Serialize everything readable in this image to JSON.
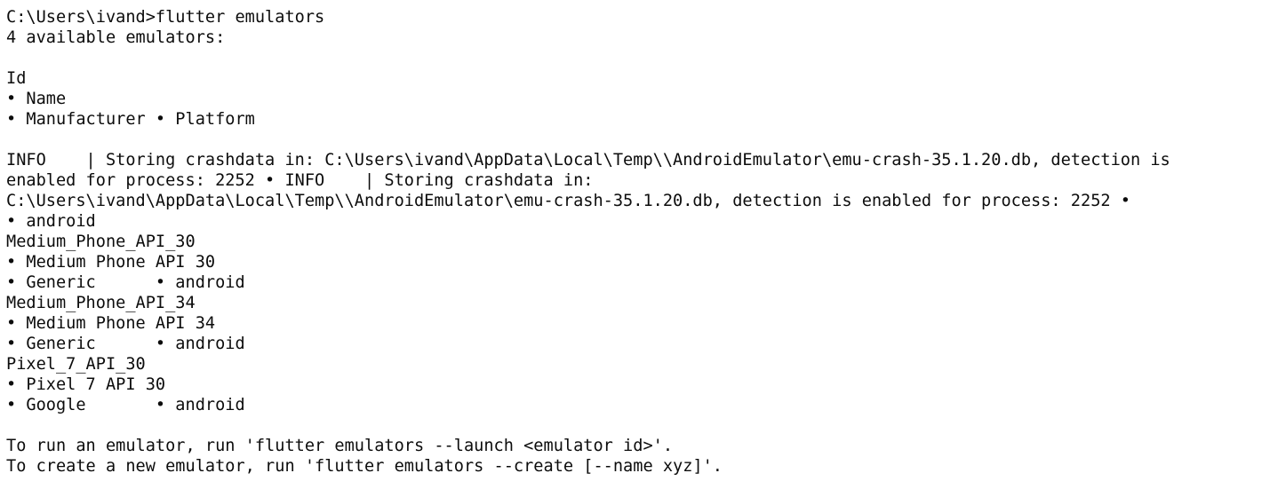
{
  "terminal": {
    "lines": [
      "C:\\Users\\ivand>flutter emulators",
      "4 available emulators:",
      "",
      "Id",
      "• Name",
      "• Manufacturer • Platform",
      "",
      "INFO    | Storing crashdata in: C:\\Users\\ivand\\AppData\\Local\\Temp\\\\AndroidEmulator\\emu-crash-35.1.20.db, detection is",
      "enabled for process: 2252 • INFO    | Storing crashdata in:",
      "C:\\Users\\ivand\\AppData\\Local\\Temp\\\\AndroidEmulator\\emu-crash-35.1.20.db, detection is enabled for process: 2252 •",
      "• android",
      "Medium_Phone_API_30",
      "• Medium Phone API 30",
      "• Generic      • android",
      "Medium_Phone_API_34",
      "• Medium Phone API 34",
      "• Generic      • android",
      "Pixel_7_API_30",
      "• Pixel 7 API 30",
      "• Google       • android",
      "",
      "To run an emulator, run 'flutter emulators --launch <emulator id>'.",
      "To create a new emulator, run 'flutter emulators --create [--name xyz]'."
    ]
  }
}
